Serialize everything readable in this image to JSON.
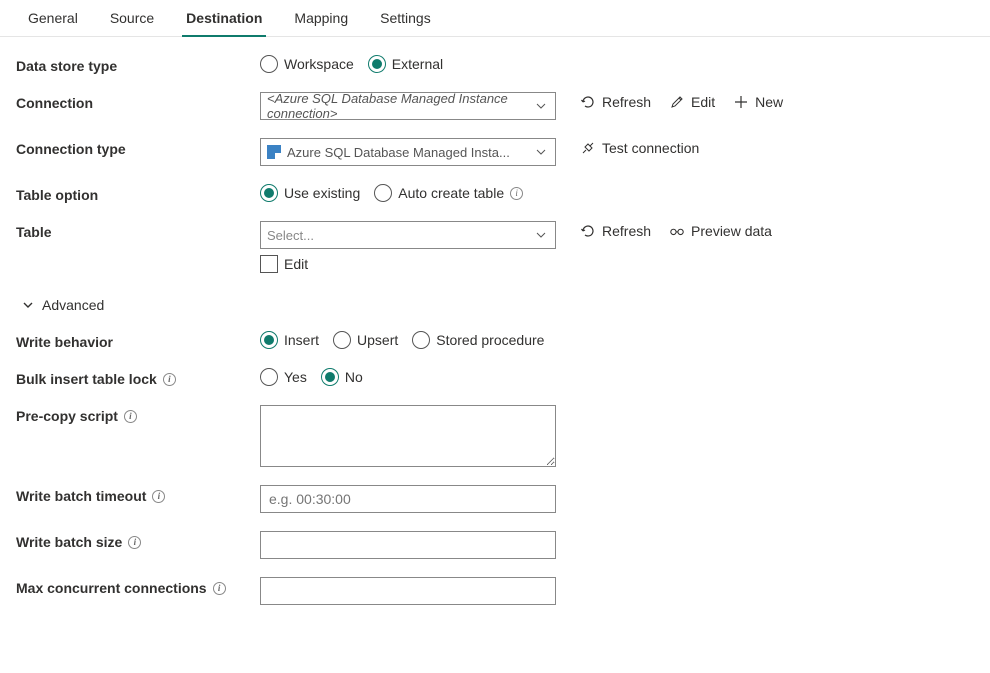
{
  "tabs": {
    "general": "General",
    "source": "Source",
    "destination": "Destination",
    "mapping": "Mapping",
    "settings": "Settings"
  },
  "labels": {
    "data_store_type": "Data store type",
    "connection": "Connection",
    "connection_type": "Connection type",
    "table_option": "Table option",
    "table": "Table",
    "advanced": "Advanced",
    "write_behavior": "Write behavior",
    "bulk_insert_lock": "Bulk insert table lock",
    "pre_copy_script": "Pre-copy script",
    "write_batch_timeout": "Write batch timeout",
    "write_batch_size": "Write batch size",
    "max_concurrent": "Max concurrent connections"
  },
  "radios": {
    "workspace": "Workspace",
    "external": "External",
    "use_existing": "Use existing",
    "auto_create": "Auto create table",
    "insert": "Insert",
    "upsert": "Upsert",
    "stored_proc": "Stored procedure",
    "yes": "Yes",
    "no": "No"
  },
  "fields": {
    "connection_value": "<Azure SQL Database Managed Instance connection>",
    "connection_type_value": "Azure SQL Database Managed Insta...",
    "table_placeholder": "Select...",
    "edit_label": "Edit",
    "timeout_placeholder": "e.g. 00:30:00"
  },
  "actions": {
    "refresh": "Refresh",
    "edit": "Edit",
    "new": "New",
    "test_connection": "Test connection",
    "preview_data": "Preview data"
  }
}
